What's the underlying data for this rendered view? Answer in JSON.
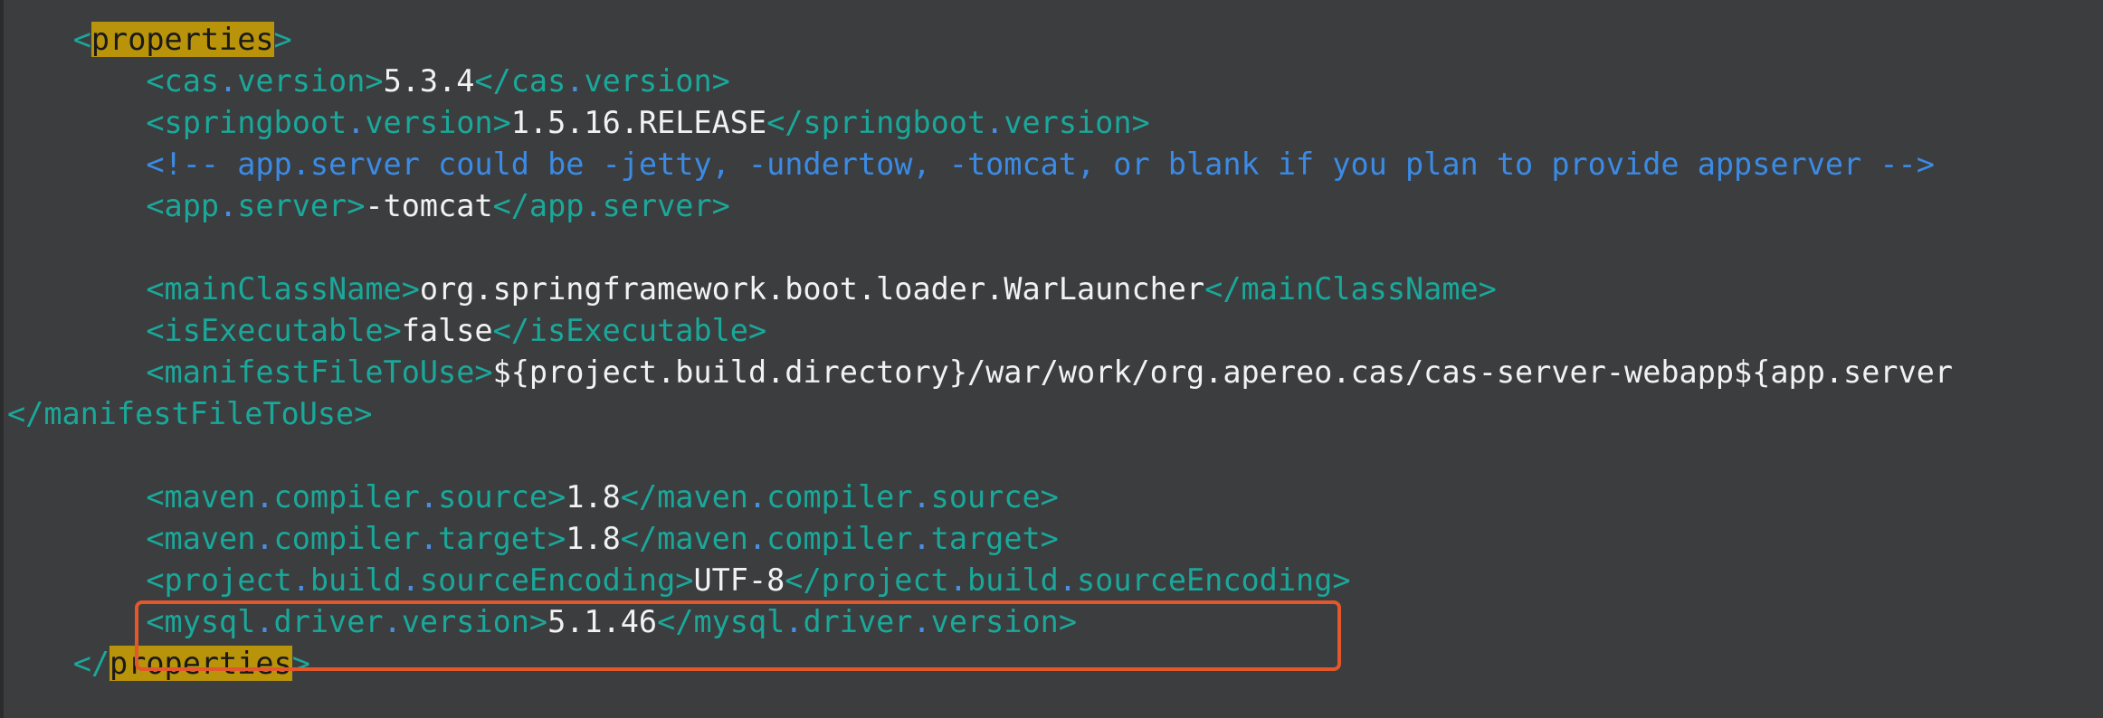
{
  "code": {
    "l1": {
      "open": "<",
      "tag": "properties",
      "close": ">"
    },
    "l2": {
      "open": "<cas",
      "dot": ".",
      "rest": "version>",
      "value": "5.3.4",
      "end_open": "</cas",
      "end_dot": ".",
      "end_rest": "version>"
    },
    "l3": {
      "open": "<springboot",
      "dot": ".",
      "rest": "version>",
      "value": "1.5.16.RELEASE",
      "end_open": "</springboot",
      "end_dot": ".",
      "end_rest": "version>"
    },
    "l4": {
      "comment": "<!-- app.server could be -jetty, -undertow, -tomcat, or blank if you plan to provide appserver -->"
    },
    "l5": {
      "open": "<app",
      "dot": ".",
      "rest": "server>",
      "value": "-tomcat",
      "end_open": "</app",
      "end_dot": ".",
      "end_rest": "server>"
    },
    "l6": {
      "open": "<mainClassName>",
      "value": "org.springframework.boot.loader.WarLauncher",
      "end": "</mainClassName>"
    },
    "l7": {
      "open": "<isExecutable>",
      "value": "false",
      "end": "</isExecutable>"
    },
    "l8": {
      "open": "<manifestFileToUse>",
      "value": "${project.build.directory}/war/work/org.apereo.cas/cas-server-webapp${app.server"
    },
    "l9": {
      "end": "</manifestFileToUse>"
    },
    "l10": {
      "a": "<maven",
      "d1": ".",
      "b": "compiler",
      "d2": ".",
      "c": "source>",
      "value": "1.8",
      "ea": "</maven",
      "ed1": ".",
      "eb": "compiler",
      "ed2": ".",
      "ec": "source>"
    },
    "l11": {
      "a": "<maven",
      "d1": ".",
      "b": "compiler",
      "d2": ".",
      "c": "target>",
      "value": "1.8",
      "ea": "</maven",
      "ed1": ".",
      "eb": "compiler",
      "ed2": ".",
      "ec": "target>"
    },
    "l12": {
      "a": "<project",
      "d1": ".",
      "b": "build",
      "d2": ".",
      "c": "sourceEncoding>",
      "value": "UTF-8",
      "ea": "</project",
      "ed1": ".",
      "eb": "build",
      "ed2": ".",
      "ec": "sourceEncoding>"
    },
    "l13": {
      "a": "<mysql",
      "d1": ".",
      "b": "driver",
      "d2": ".",
      "c": "version>",
      "value": "5.1.46",
      "ea": "</mysql",
      "ed1": ".",
      "eb": "driver",
      "ed2": ".",
      "ec": "version>"
    },
    "l14": {
      "open": "</",
      "tag": "properties",
      "close": ">"
    }
  },
  "colors": {
    "background": "#3c3d3f",
    "tag": "#1aa89a",
    "dot": "#4a8ee0",
    "value": "#f2f2f2",
    "comment": "#3b8be5",
    "match_highlight": "#b9930a",
    "annotation_box": "#e2572c"
  }
}
